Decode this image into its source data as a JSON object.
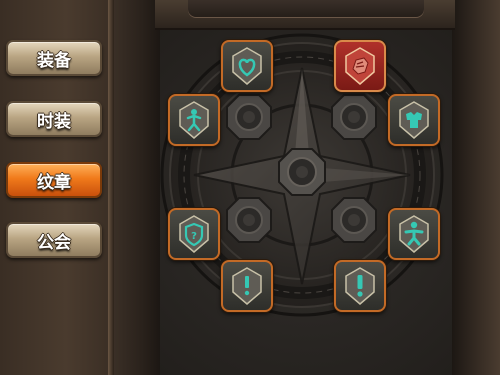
{
  "tabs": [
    {
      "label": "装备",
      "active": false
    },
    {
      "label": "时装",
      "active": false
    },
    {
      "label": "纹章",
      "active": true
    },
    {
      "label": "公会",
      "active": false
    }
  ],
  "emblems": [
    {
      "icon": "heart-icon",
      "color": "#35c8b4"
    },
    {
      "icon": "fist-icon",
      "color": "#e08b7a"
    },
    {
      "icon": "figure-icon",
      "color": "#35c8b4"
    },
    {
      "icon": "armor-icon",
      "color": "#35c8b4"
    },
    {
      "icon": "shield-icon",
      "color": "#35c8b4"
    },
    {
      "icon": "figure-icon",
      "color": "#35c8b4"
    },
    {
      "icon": "exclamation-icon",
      "color": "#35c8b4"
    },
    {
      "icon": "exclamation-icon",
      "color": "#35c8b4"
    }
  ],
  "colors": {
    "accent": "#f07a1b",
    "emblem_border": "#c36a26",
    "emblem_icon": "#35c8b4"
  }
}
